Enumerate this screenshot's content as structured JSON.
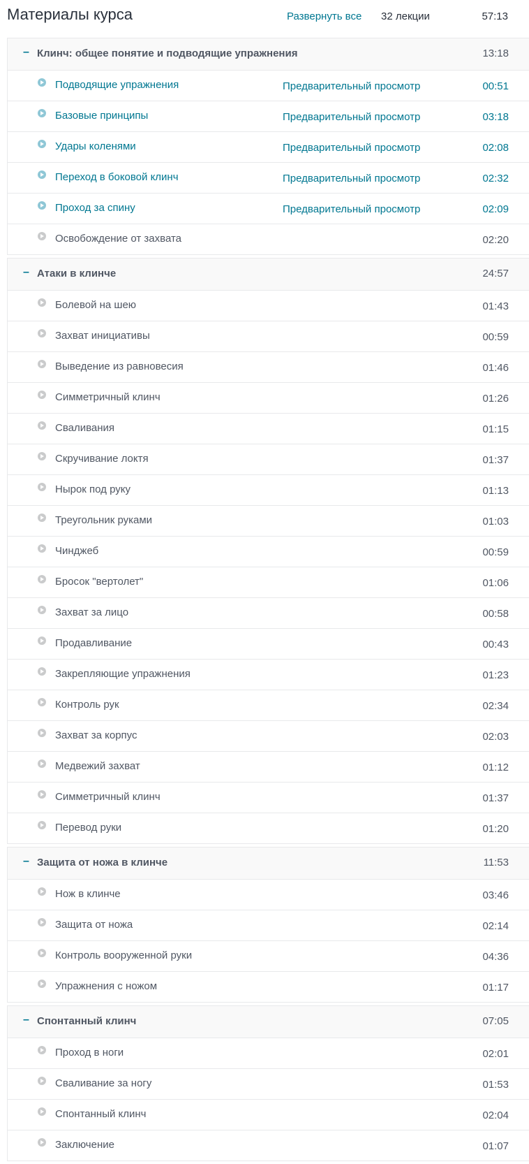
{
  "header": {
    "title": "Материалы курса",
    "expand_all": "Развернуть все",
    "lectures_count": "32 лекции",
    "total_duration": "57:13"
  },
  "sections": [
    {
      "toggle": "–",
      "title": "Клинч: общее понятие и подводящие упражнения",
      "duration": "13:18",
      "lectures": [
        {
          "title": "Подводящие упражнения",
          "preview": "Предварительный просмотр",
          "duration": "00:51"
        },
        {
          "title": "Базовые принципы",
          "preview": "Предварительный просмотр",
          "duration": "03:18"
        },
        {
          "title": "Удары коленями",
          "preview": "Предварительный просмотр",
          "duration": "02:08"
        },
        {
          "title": "Переход в боковой клинч",
          "preview": "Предварительный просмотр",
          "duration": "02:32"
        },
        {
          "title": "Проход за спину",
          "preview": "Предварительный просмотр",
          "duration": "02:09"
        },
        {
          "title": "Освобождение от захвата",
          "preview": "",
          "duration": "02:20"
        }
      ]
    },
    {
      "toggle": "–",
      "title": "Атаки в клинче",
      "duration": "24:57",
      "lectures": [
        {
          "title": "Болевой на шею",
          "preview": "",
          "duration": "01:43"
        },
        {
          "title": "Захват инициативы",
          "preview": "",
          "duration": "00:59"
        },
        {
          "title": "Выведение из равновесия",
          "preview": "",
          "duration": "01:46"
        },
        {
          "title": "Симметричный клинч",
          "preview": "",
          "duration": "01:26"
        },
        {
          "title": "Сваливания",
          "preview": "",
          "duration": "01:15"
        },
        {
          "title": "Скручивание локтя",
          "preview": "",
          "duration": "01:37"
        },
        {
          "title": "Нырок под руку",
          "preview": "",
          "duration": "01:13"
        },
        {
          "title": "Треугольник руками",
          "preview": "",
          "duration": "01:03"
        },
        {
          "title": "Чинджеб",
          "preview": "",
          "duration": "00:59"
        },
        {
          "title": "Бросок \"вертолет\"",
          "preview": "",
          "duration": "01:06"
        },
        {
          "title": "Захват за лицо",
          "preview": "",
          "duration": "00:58"
        },
        {
          "title": "Продавливание",
          "preview": "",
          "duration": "00:43"
        },
        {
          "title": "Закрепляющие упражнения",
          "preview": "",
          "duration": "01:23"
        },
        {
          "title": "Контроль рук",
          "preview": "",
          "duration": "02:34"
        },
        {
          "title": "Захват за корпус",
          "preview": "",
          "duration": "02:03"
        },
        {
          "title": "Медвежий захват",
          "preview": "",
          "duration": "01:12"
        },
        {
          "title": "Симметричный клинч",
          "preview": "",
          "duration": "01:37"
        },
        {
          "title": "Перевод руки",
          "preview": "",
          "duration": "01:20"
        }
      ]
    },
    {
      "toggle": "–",
      "title": "Защита от ножа в клинче",
      "duration": "11:53",
      "lectures": [
        {
          "title": "Нож в клинче",
          "preview": "",
          "duration": "03:46"
        },
        {
          "title": "Защита от ножа",
          "preview": "",
          "duration": "02:14"
        },
        {
          "title": "Контроль вооруженной руки",
          "preview": "",
          "duration": "04:36"
        },
        {
          "title": "Упражнения с ножом",
          "preview": "",
          "duration": "01:17"
        }
      ]
    },
    {
      "toggle": "–",
      "title": "Спонтанный клинч",
      "duration": "07:05",
      "lectures": [
        {
          "title": "Проход в ноги",
          "preview": "",
          "duration": "02:01"
        },
        {
          "title": "Сваливание за ногу",
          "preview": "",
          "duration": "01:53"
        },
        {
          "title": "Спонтанный клинч",
          "preview": "",
          "duration": "02:04"
        },
        {
          "title": "Заключение",
          "preview": "",
          "duration": "01:07"
        }
      ]
    }
  ],
  "icons": {
    "lecture": "play-circle-icon"
  },
  "colors": {
    "link": "#007791",
    "text": "#505763",
    "section_bg": "#f9f9f9",
    "border": "#e8e9eb"
  }
}
